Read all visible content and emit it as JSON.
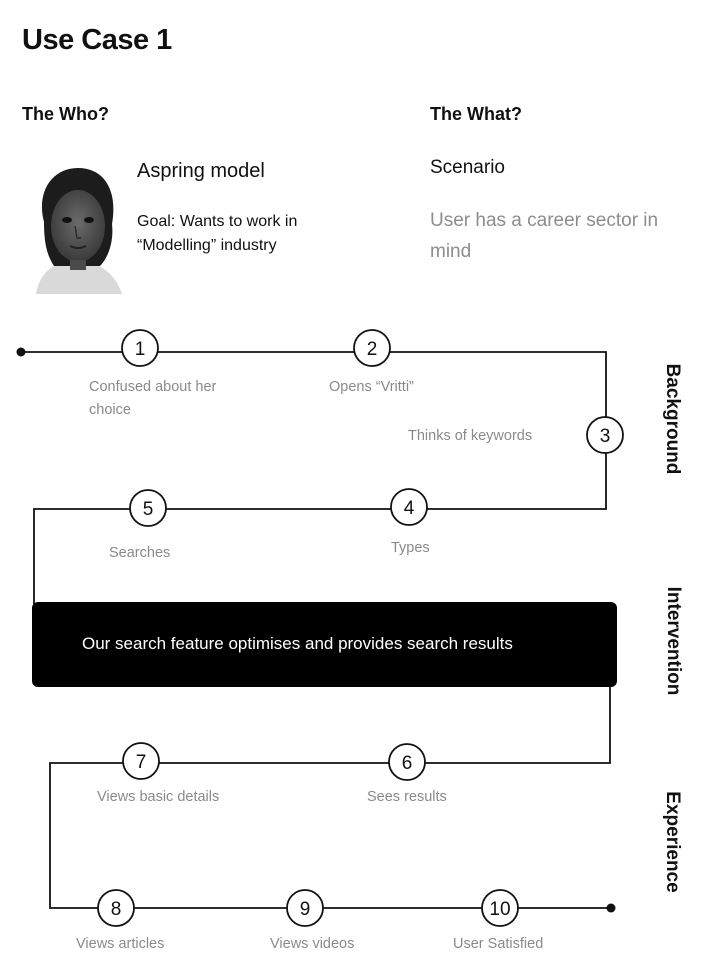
{
  "title": "Use Case 1",
  "who": {
    "heading": "The Who?",
    "persona_name": "Aspring model",
    "goal": "Goal: Wants to work in “Modelling” industry"
  },
  "what": {
    "heading": "The What?",
    "scenario_heading": "Scenario",
    "scenario_text": "User has a career sector in mind"
  },
  "stages": {
    "background": "Background",
    "intervention": "Intervention",
    "experience": "Experience"
  },
  "intervention_text": "Our search feature optimises and provides search results",
  "steps": [
    {
      "num": "1",
      "label": "Confused about her choice"
    },
    {
      "num": "2",
      "label": "Opens “Vritti”"
    },
    {
      "num": "3",
      "label": "Thinks of keywords"
    },
    {
      "num": "4",
      "label": "Types"
    },
    {
      "num": "5",
      "label": "Searches"
    },
    {
      "num": "6",
      "label": "Sees results"
    },
    {
      "num": "7",
      "label": "Views basic details"
    },
    {
      "num": "8",
      "label": "Views articles"
    },
    {
      "num": "9",
      "label": "Views videos"
    },
    {
      "num": "10",
      "label": "User Satisfied"
    }
  ],
  "colors": {
    "line": "#111111",
    "label_gray": "#8a8a8a",
    "banner_bg": "#000000"
  }
}
